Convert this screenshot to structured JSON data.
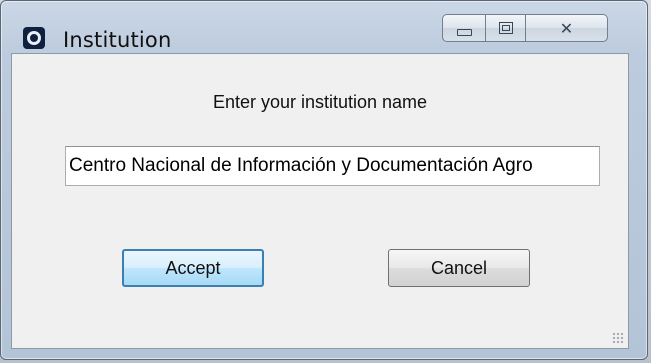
{
  "window": {
    "title": "Institution",
    "close_glyph": "✕",
    "icons": {
      "app": "app-logo-icon",
      "minimize": "minimize-icon",
      "maximize": "maximize-icon",
      "close": "close-icon"
    }
  },
  "form": {
    "prompt": "Enter your institution name",
    "institution_value": "Centro Nacional de Información y Documentación Agro"
  },
  "buttons": {
    "accept_label": "Accept",
    "cancel_label": "Cancel"
  },
  "colors": {
    "accent_default_button": "#3c7fb1",
    "title_bar": "#bccbdd",
    "client_background": "#f0f0f0"
  }
}
